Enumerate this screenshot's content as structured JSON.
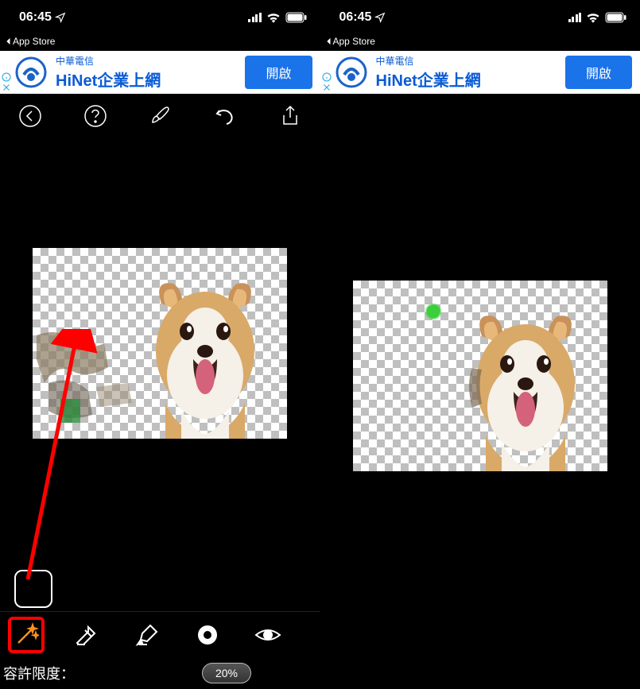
{
  "status": {
    "time": "06:45",
    "back_app_label": "App Store"
  },
  "ad": {
    "brand_small": "中華電信",
    "brand_main": "HiNet企業上網",
    "button_label": "開啟"
  },
  "tolerance": {
    "label": "容許限度：",
    "value": "20%"
  },
  "icons": {
    "back": "back-circle",
    "help": "help-circle",
    "brush": "paint-brush",
    "undo": "undo",
    "share": "share",
    "wand": "magic-wand",
    "eraser": "eraser",
    "marker": "highlighter",
    "target": "target-circle",
    "eye": "eye-visibility"
  }
}
